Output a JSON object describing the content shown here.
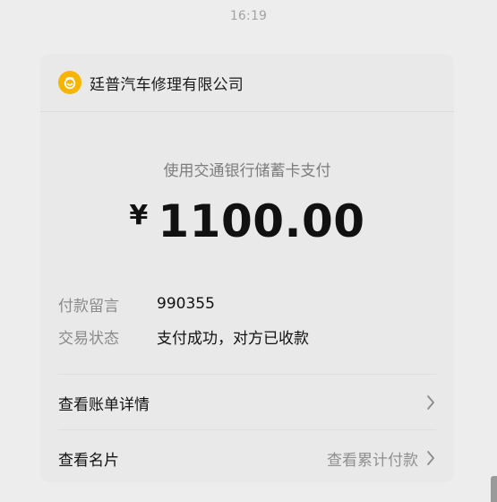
{
  "header": {
    "time": "16:19"
  },
  "merchant": {
    "name": "廷普汽车修理有限公司",
    "logo_icon": "wechat-pay-merchant-icon",
    "logo_color": "#f7b500"
  },
  "payment": {
    "method": "使用交通银行储蓄卡支付",
    "currency": "¥",
    "amount": "1100.00"
  },
  "details": [
    {
      "label": "付款留言",
      "value": "990355"
    },
    {
      "label": "交易状态",
      "value": "支付成功，对方已收款"
    }
  ],
  "links": {
    "bill_details": "查看账单详情",
    "view_card": "查看名片",
    "view_total": "查看累计付款"
  },
  "icons": {
    "chevron": "chevron-right-icon"
  }
}
